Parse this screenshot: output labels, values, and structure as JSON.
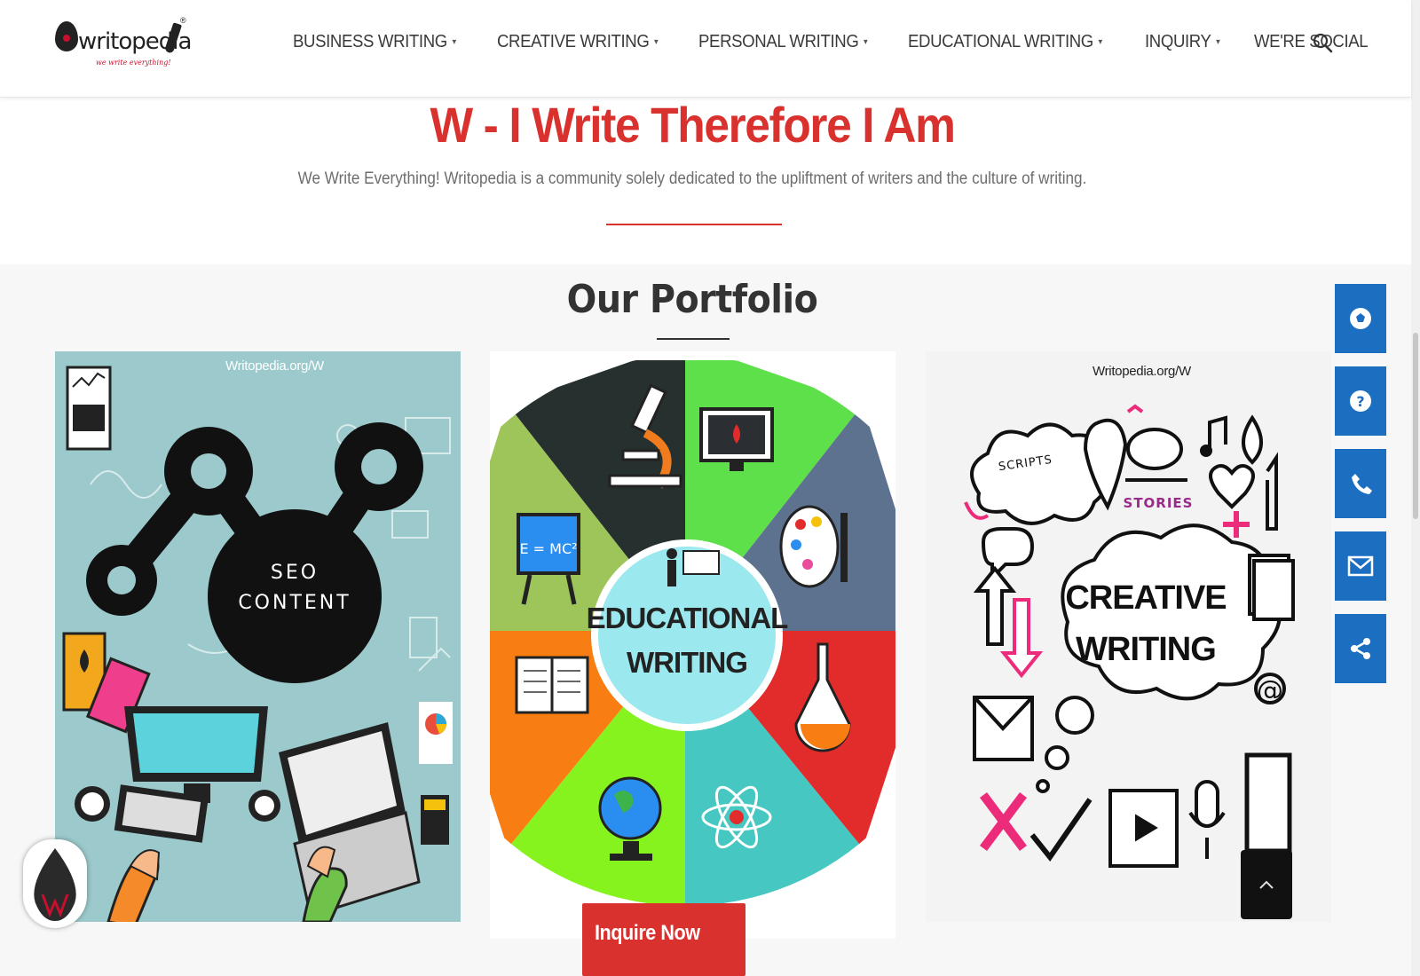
{
  "brand": {
    "logo_text": "writopedia",
    "logo_registered": "®",
    "logo_tagline": "we write everything!"
  },
  "nav": {
    "items": [
      {
        "label": "BUSINESS WRITING",
        "has_dropdown": true
      },
      {
        "label": "CREATIVE WRITING",
        "has_dropdown": true
      },
      {
        "label": "PERSONAL WRITING",
        "has_dropdown": true
      },
      {
        "label": "EDUCATIONAL WRITING",
        "has_dropdown": true
      },
      {
        "label": "INQUIRY",
        "has_dropdown": true
      },
      {
        "label": "WE'RE SOCIAL",
        "has_dropdown": false
      }
    ],
    "caret": "▾",
    "search_icon": "search-icon"
  },
  "hero": {
    "title": "W - I Write Therefore I Am",
    "subtitle": "We Write Everything! Writopedia is a community solely dedicated to the upliftment of writers and the culture of writing."
  },
  "portfolio": {
    "title": "Our Portfolio",
    "cards": [
      {
        "name": "seo-content",
        "watermark": "Writopedia.org/W",
        "text_lines": [
          "SEO",
          "CONTENT"
        ]
      },
      {
        "name": "educational-writing",
        "watermark": "",
        "text_lines": [
          "EDUCATIONAL",
          "WRITING"
        ],
        "board_text": "E = MC²"
      },
      {
        "name": "creative-writing",
        "watermark": "Writopedia.org/W",
        "text_lines": [
          "CREATIVE",
          "WRITING"
        ],
        "doodle_labels": [
          "SCRIPTS",
          "STORIES",
          "@"
        ]
      }
    ]
  },
  "social_bar": {
    "icons": [
      "football-icon",
      "help-icon",
      "phone-icon",
      "mail-icon",
      "share-icon"
    ]
  },
  "actions": {
    "inquire_label": "Inquire Now",
    "back_to_top_icon": "chevron-up-icon"
  },
  "colors": {
    "accent_red": "#d9322e",
    "social_blue": "#1c6fc0",
    "seo_bg": "#9cc9cb"
  }
}
